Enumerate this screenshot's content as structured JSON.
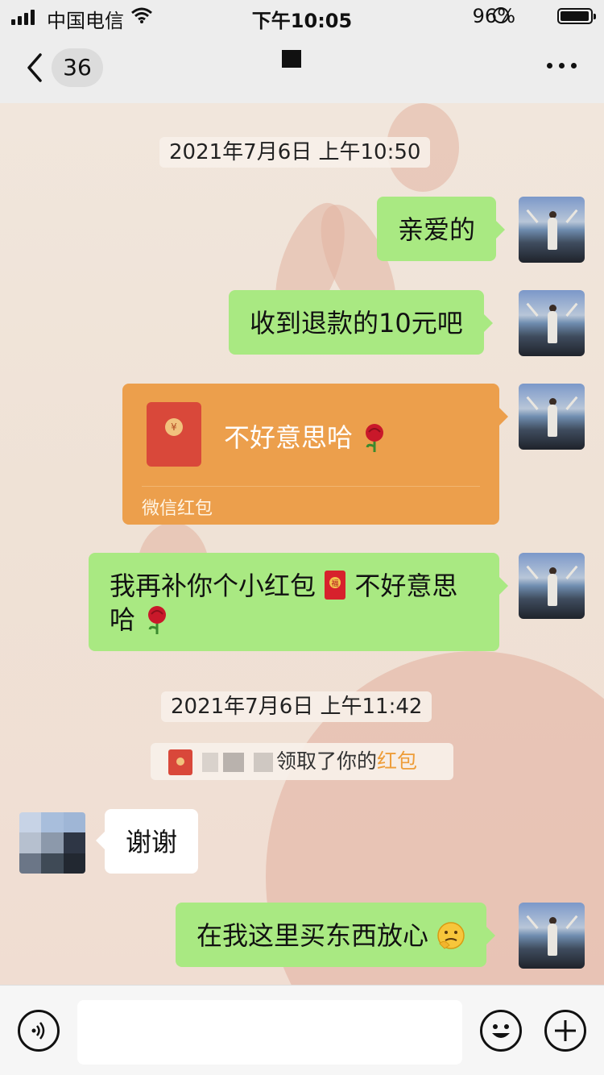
{
  "status_bar": {
    "carrier": "中国电信",
    "time": "下午10:05",
    "battery_percent": "96%",
    "battery_level": 0.96
  },
  "nav": {
    "back_count": "36"
  },
  "messages": {
    "timestamp1": "2021年7月6日 上午10:50",
    "m1": "亲爱的",
    "m2": "收到退款的10元吧",
    "red_packet": {
      "text": "不好意思哈",
      "label": "微信红包"
    },
    "m4_line1": "我再补你个小红包",
    "m4_after_icon": "不好意思",
    "m4_line2": "哈",
    "timestamp2": "2021年7月6日 上午11:42",
    "system_note": {
      "text": "领取了你的",
      "highlight": "红包"
    },
    "m5_other": "谢谢",
    "m6": "在我这里买东西放心"
  },
  "icons": [
    "back-chevron-icon",
    "more-icon",
    "rose-emoji",
    "fu-red-packet-emoji",
    "voice-icon",
    "emoji-icon",
    "plus-icon"
  ],
  "colors": {
    "bubble_green": "#a9e982",
    "red_packet": "#ec9f4c",
    "highlight": "#ee9d39"
  }
}
